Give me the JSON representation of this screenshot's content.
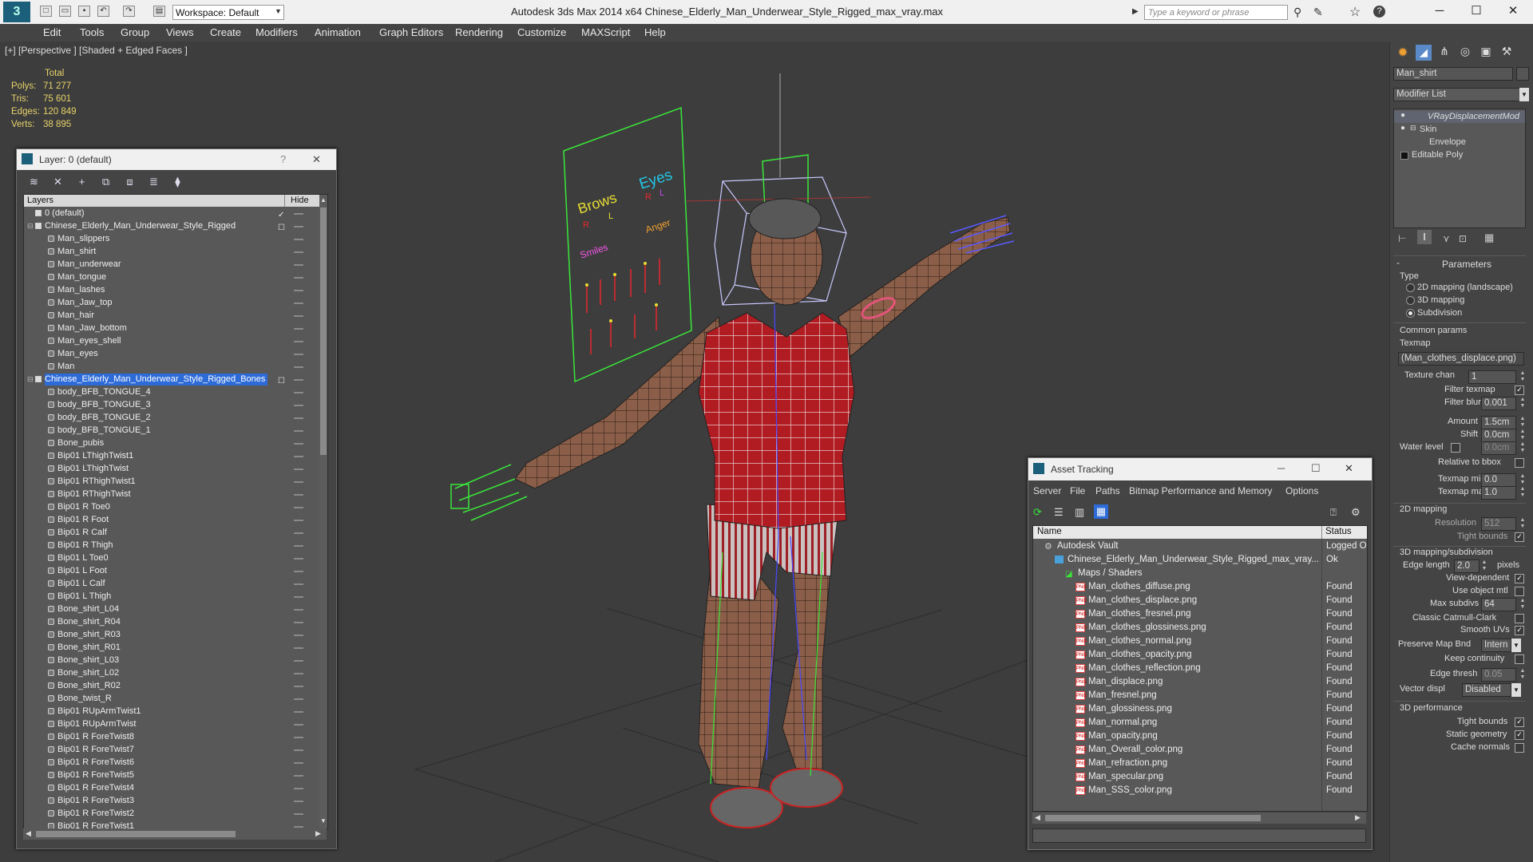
{
  "app": {
    "title": "Autodesk 3ds Max  2014 x64     Chinese_Elderly_Man_Underwear_Style_Rigged_max_vray.max",
    "workspace": "Workspace: Default",
    "search_placeholder": "Type a keyword or phrase"
  },
  "menu": [
    "Edit",
    "Tools",
    "Group",
    "Views",
    "Create",
    "Modifiers",
    "Animation",
    "Graph Editors",
    "Rendering",
    "Customize",
    "MAXScript",
    "Help"
  ],
  "viewport": {
    "label": "[+] [Perspective ] [Shaded + Edged Faces ]",
    "stats": {
      "header": "Total",
      "rows": [
        {
          "k": "Polys:",
          "v": "71 277"
        },
        {
          "k": "Tris:",
          "v": "75 601"
        },
        {
          "k": "Edges:",
          "v": "120 849"
        },
        {
          "k": "Verts:",
          "v": "38 895"
        }
      ]
    },
    "board_labels": {
      "brows": "Brows",
      "eyes": "Eyes",
      "smiles": "Smiles",
      "anger": "Anger",
      "l1": "L",
      "r1": "R",
      "l2": "L",
      "r2": "R"
    }
  },
  "layer_panel": {
    "title": "Layer: 0 (default)",
    "help": "?",
    "close": "✕",
    "col_layers": "Layers",
    "col_hide": "Hide",
    "rows": [
      {
        "name": "0 (default)",
        "level": 0,
        "kind": "layer"
      },
      {
        "name": "Chinese_Elderly_Man_Underwear_Style_Rigged",
        "level": 0,
        "kind": "layer"
      },
      {
        "name": "Man_slippers",
        "level": 1,
        "kind": "obj"
      },
      {
        "name": "Man_shirt",
        "level": 1,
        "kind": "obj"
      },
      {
        "name": "Man_underwear",
        "level": 1,
        "kind": "obj"
      },
      {
        "name": "Man_tongue",
        "level": 1,
        "kind": "obj"
      },
      {
        "name": "Man_lashes",
        "level": 1,
        "kind": "obj"
      },
      {
        "name": "Man_Jaw_top",
        "level": 1,
        "kind": "obj"
      },
      {
        "name": "Man_hair",
        "level": 1,
        "kind": "obj"
      },
      {
        "name": "Man_Jaw_bottom",
        "level": 1,
        "kind": "obj"
      },
      {
        "name": "Man_eyes_shell",
        "level": 1,
        "kind": "obj"
      },
      {
        "name": "Man_eyes",
        "level": 1,
        "kind": "obj"
      },
      {
        "name": "Man",
        "level": 1,
        "kind": "obj"
      },
      {
        "name": "Chinese_Elderly_Man_Underwear_Style_Rigged_Bones",
        "level": 0,
        "kind": "layer",
        "selected": true
      },
      {
        "name": "body_BFB_TONGUE_4",
        "level": 1,
        "kind": "obj"
      },
      {
        "name": "body_BFB_TONGUE_3",
        "level": 1,
        "kind": "obj"
      },
      {
        "name": "body_BFB_TONGUE_2",
        "level": 1,
        "kind": "obj"
      },
      {
        "name": "body_BFB_TONGUE_1",
        "level": 1,
        "kind": "obj"
      },
      {
        "name": "Bone_pubis",
        "level": 1,
        "kind": "obj"
      },
      {
        "name": "Bip01 LThighTwist1",
        "level": 1,
        "kind": "obj"
      },
      {
        "name": "Bip01 LThighTwist",
        "level": 1,
        "kind": "obj"
      },
      {
        "name": "Bip01 RThighTwist1",
        "level": 1,
        "kind": "obj"
      },
      {
        "name": "Bip01 RThighTwist",
        "level": 1,
        "kind": "obj"
      },
      {
        "name": "Bip01 R Toe0",
        "level": 1,
        "kind": "obj"
      },
      {
        "name": "Bip01 R Foot",
        "level": 1,
        "kind": "obj"
      },
      {
        "name": "Bip01 R Calf",
        "level": 1,
        "kind": "obj"
      },
      {
        "name": "Bip01 R Thigh",
        "level": 1,
        "kind": "obj"
      },
      {
        "name": "Bip01 L Toe0",
        "level": 1,
        "kind": "obj"
      },
      {
        "name": "Bip01 L Foot",
        "level": 1,
        "kind": "obj"
      },
      {
        "name": "Bip01 L Calf",
        "level": 1,
        "kind": "obj"
      },
      {
        "name": "Bip01 L Thigh",
        "level": 1,
        "kind": "obj"
      },
      {
        "name": "Bone_shirt_L04",
        "level": 1,
        "kind": "obj"
      },
      {
        "name": "Bone_shirt_R04",
        "level": 1,
        "kind": "obj"
      },
      {
        "name": "Bone_shirt_R03",
        "level": 1,
        "kind": "obj"
      },
      {
        "name": "Bone_shirt_R01",
        "level": 1,
        "kind": "obj"
      },
      {
        "name": "Bone_shirt_L03",
        "level": 1,
        "kind": "obj"
      },
      {
        "name": "Bone_shirt_L02",
        "level": 1,
        "kind": "obj"
      },
      {
        "name": "Bone_shirt_R02",
        "level": 1,
        "kind": "obj"
      },
      {
        "name": "Bone_twist_R",
        "level": 1,
        "kind": "obj"
      },
      {
        "name": "Bip01 RUpArmTwist1",
        "level": 1,
        "kind": "obj"
      },
      {
        "name": "Bip01 RUpArmTwist",
        "level": 1,
        "kind": "obj"
      },
      {
        "name": "Bip01 R ForeTwist8",
        "level": 1,
        "kind": "obj"
      },
      {
        "name": "Bip01 R ForeTwist7",
        "level": 1,
        "kind": "obj"
      },
      {
        "name": "Bip01 R ForeTwist6",
        "level": 1,
        "kind": "obj"
      },
      {
        "name": "Bip01 R ForeTwist5",
        "level": 1,
        "kind": "obj"
      },
      {
        "name": "Bip01 R ForeTwist4",
        "level": 1,
        "kind": "obj"
      },
      {
        "name": "Bip01 R ForeTwist3",
        "level": 1,
        "kind": "obj"
      },
      {
        "name": "Bip01 R ForeTwist2",
        "level": 1,
        "kind": "obj"
      },
      {
        "name": "Bip01 R ForeTwist1",
        "level": 1,
        "kind": "obj"
      }
    ]
  },
  "asset_tracking": {
    "title": "Asset Tracking",
    "menu": [
      "Server",
      "File",
      "Paths",
      "Bitmap Performance and Memory",
      "Options"
    ],
    "col_name": "Name",
    "col_status": "Status",
    "rows": [
      {
        "name": "Autodesk Vault",
        "status": "Logged O",
        "level": 0,
        "kind": "vault"
      },
      {
        "name": "Chinese_Elderly_Man_Underwear_Style_Rigged_max_vray...",
        "status": "Ok",
        "level": 1,
        "kind": "max"
      },
      {
        "name": "Maps / Shaders",
        "status": "",
        "level": 2,
        "kind": "folder"
      },
      {
        "name": "Man_clothes_diffuse.png",
        "status": "Found",
        "level": 3,
        "kind": "png"
      },
      {
        "name": "Man_clothes_displace.png",
        "status": "Found",
        "level": 3,
        "kind": "png"
      },
      {
        "name": "Man_clothes_fresnel.png",
        "status": "Found",
        "level": 3,
        "kind": "png"
      },
      {
        "name": "Man_clothes_glossiness.png",
        "status": "Found",
        "level": 3,
        "kind": "png"
      },
      {
        "name": "Man_clothes_normal.png",
        "status": "Found",
        "level": 3,
        "kind": "png"
      },
      {
        "name": "Man_clothes_opacity.png",
        "status": "Found",
        "level": 3,
        "kind": "png"
      },
      {
        "name": "Man_clothes_reflection.png",
        "status": "Found",
        "level": 3,
        "kind": "png"
      },
      {
        "name": "Man_displace.png",
        "status": "Found",
        "level": 3,
        "kind": "png"
      },
      {
        "name": "Man_fresnel.png",
        "status": "Found",
        "level": 3,
        "kind": "png"
      },
      {
        "name": "Man_glossiness.png",
        "status": "Found",
        "level": 3,
        "kind": "png"
      },
      {
        "name": "Man_normal.png",
        "status": "Found",
        "level": 3,
        "kind": "png"
      },
      {
        "name": "Man_opacity.png",
        "status": "Found",
        "level": 3,
        "kind": "png"
      },
      {
        "name": "Man_Overall_color.png",
        "status": "Found",
        "level": 3,
        "kind": "png"
      },
      {
        "name": "Man_refraction.png",
        "status": "Found",
        "level": 3,
        "kind": "png"
      },
      {
        "name": "Man_specular.png",
        "status": "Found",
        "level": 3,
        "kind": "png"
      },
      {
        "name": "Man_SSS_color.png",
        "status": "Found",
        "level": 3,
        "kind": "png"
      }
    ]
  },
  "command_panel": {
    "object_name": "Man_shirt",
    "modifier_list": "Modifier List",
    "stack": [
      "VRayDisplacementMod",
      "Skin",
      "Envelope",
      "Editable Poly"
    ],
    "parameters_header": "Parameters",
    "type_label": "Type",
    "type_options": [
      "2D mapping (landscape)",
      "3D mapping",
      "Subdivision"
    ],
    "type_selected": "Subdivision",
    "common_params": "Common params",
    "texmap_label": "Texmap",
    "texmap_value": "(Man_clothes_displace.png)",
    "texture_chan_label": "Texture chan",
    "texture_chan_value": "1",
    "filter_texmap": "Filter texmap",
    "filter_blur_label": "Filter blur",
    "filter_blur_value": "0.001",
    "amount_label": "Amount",
    "amount_value": "1.5cm",
    "shift_label": "Shift",
    "shift_value": "0.0cm",
    "water_level_label": "Water level",
    "water_level_value": "0.0cm",
    "relative_to_bbox": "Relative to bbox",
    "texmap_min_label": "Texmap min",
    "texmap_min_value": "0.0",
    "texmap_max_label": "Texmap max",
    "texmap_max_value": "1.0",
    "mapping_2d": "2D mapping",
    "resolution_label": "Resolution",
    "resolution_value": "512",
    "tight_bounds": "Tight bounds",
    "mapping_3d": "3D mapping/subdivision",
    "edge_length_label": "Edge length",
    "edge_length_value": "2.0",
    "pixels": "pixels",
    "view_dependent": "View-dependent",
    "use_object_mtl": "Use object mtl",
    "max_subdivs_label": "Max subdivs",
    "max_subdivs_value": "64",
    "classic_catmull": "Classic Catmull-Clark",
    "smooth_uvs": "Smooth UVs",
    "preserve_map_bnd": "Preserve Map Bnd",
    "preserve_map_value": "Intern",
    "keep_continuity": "Keep continuity",
    "edge_thresh_label": "Edge thresh",
    "edge_thresh_value": "0.05",
    "vector_displ_label": "Vector displ",
    "vector_displ_value": "Disabled",
    "perf_3d": "3D performance",
    "tight_bounds2": "Tight bounds",
    "static_geometry": "Static geometry",
    "cache_normals": "Cache normals"
  },
  "colors": {
    "accent": "#2d6bd8",
    "wire_green": "#39e639",
    "shirt_red": "#b01c22",
    "skin": "#8a5e48",
    "stat_yellow": "#e8d36a"
  }
}
